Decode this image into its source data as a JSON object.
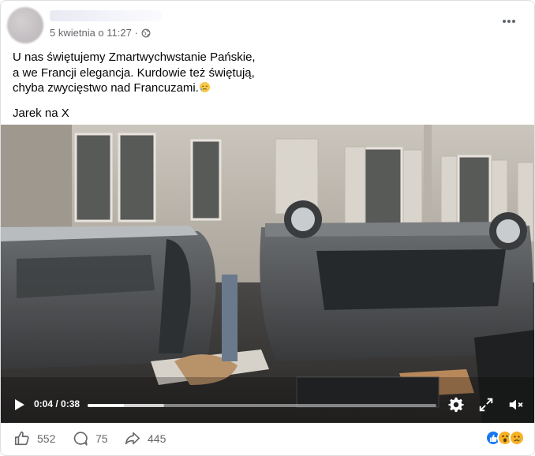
{
  "post": {
    "timestamp": "5 kwietnia o 11:27 ·",
    "privacy_icon": "globe-icon",
    "text_line1": "U nas świętujemy Zmartwychwstanie Pańskie,",
    "text_line2": "a we Francji elegancja. Kurdowie też świętują,",
    "text_line3": "chyba zwycięstwo nad Francuzami.",
    "signature": "Jarek na X"
  },
  "video": {
    "time": "0:04 / 0:38",
    "progress_fraction": 0.105,
    "buffered_fraction": 0.22
  },
  "footer": {
    "likes": "552",
    "comments": "75",
    "shares": "445",
    "reactions": [
      "like-icon",
      "wow-icon",
      "sad-icon"
    ]
  },
  "colors": {
    "meta_text": "#65676b",
    "like_blue": "#1877f2",
    "reaction_yellow": "#f7b125"
  }
}
